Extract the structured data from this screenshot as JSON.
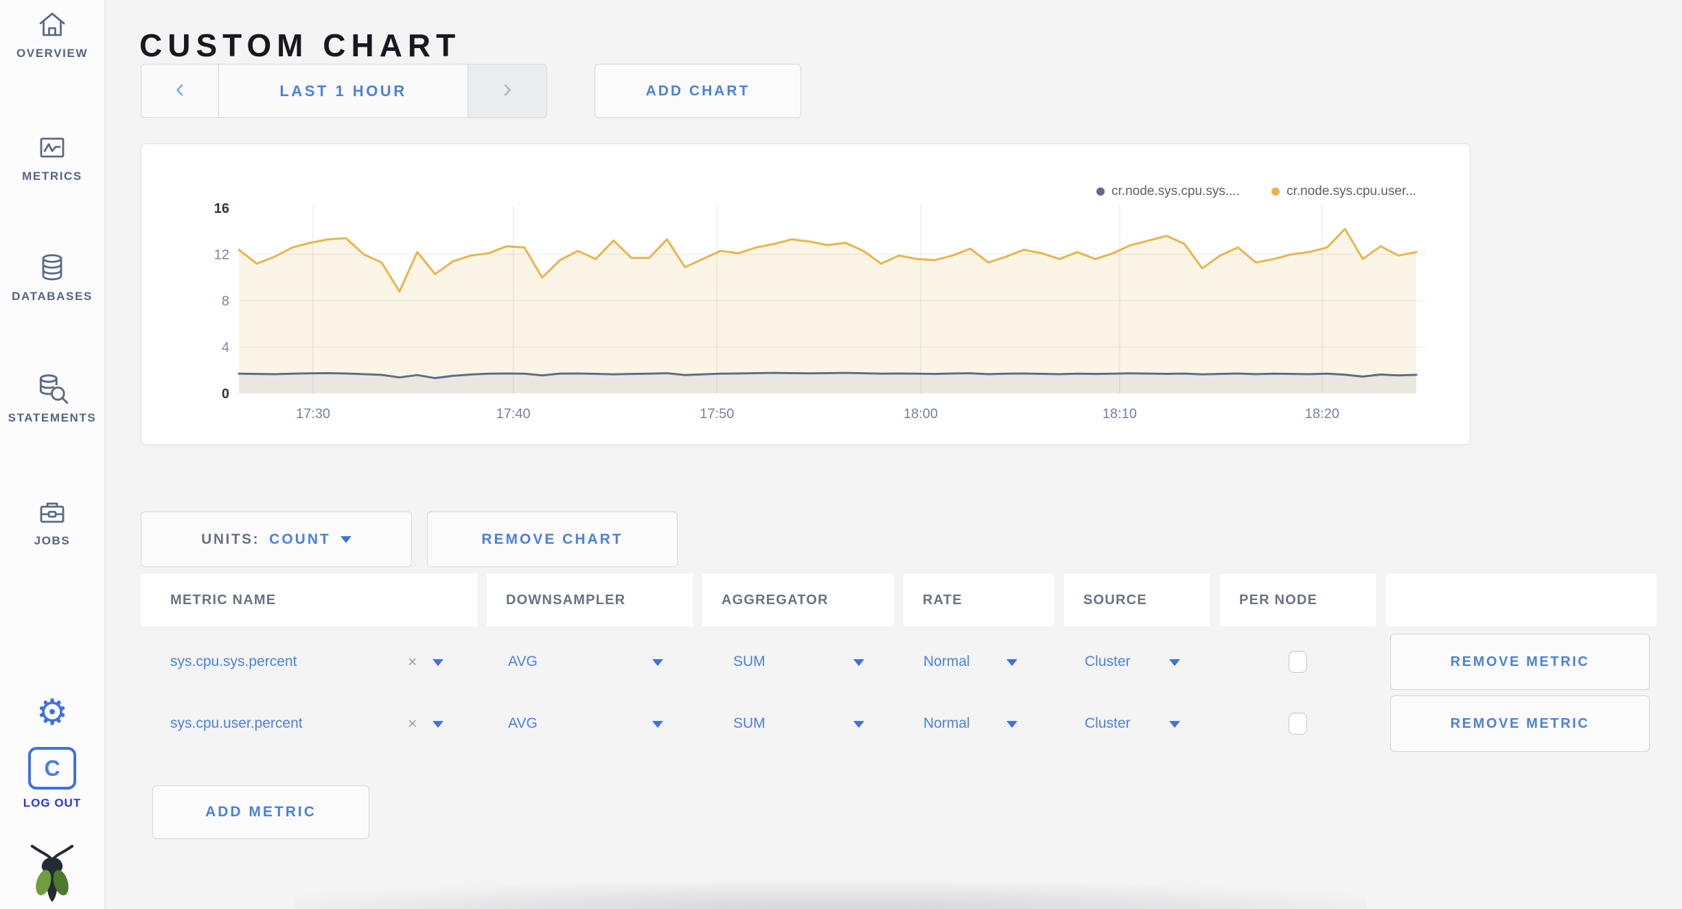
{
  "header": {
    "title": "CUSTOM CHART"
  },
  "sidebar": {
    "items": [
      {
        "label": "OVERVIEW",
        "icon": "home-icon"
      },
      {
        "label": "METRICS",
        "icon": "metrics-chart-icon"
      },
      {
        "label": "DATABASES",
        "icon": "database-icon"
      },
      {
        "label": "STATEMENTS",
        "icon": "statements-search-icon"
      },
      {
        "label": "JOBS",
        "icon": "briefcase-icon"
      }
    ],
    "settings_icon": "gear-icon",
    "settings_glyph": "⚙",
    "logout_icon": "cockroach-c-icon",
    "logout_monogram": "C",
    "logout_label": "LOG OUT",
    "brand_icon": "cockroachdb-bug-logo"
  },
  "toolbar": {
    "prev_icon": "‹",
    "time_range_label": "LAST 1 HOUR",
    "next_icon": "›",
    "add_chart_label": "ADD CHART"
  },
  "icons": {
    "dropdown": "triangle-down",
    "clear": "×"
  },
  "units_bar": {
    "units_label": "UNITS:",
    "units_value": "COUNT",
    "remove_chart_label": "REMOVE CHART"
  },
  "table": {
    "columns": [
      "METRIC NAME",
      "DOWNSAMPLER",
      "AGGREGATOR",
      "RATE",
      "SOURCE",
      "PER NODE"
    ],
    "rows": [
      {
        "metric": "sys.cpu.sys.percent",
        "downsampler": "AVG",
        "aggregator": "SUM",
        "rate": "Normal",
        "source": "Cluster",
        "per_node_checked": false,
        "remove_label": "REMOVE METRIC"
      },
      {
        "metric": "sys.cpu.user.percent",
        "downsampler": "AVG",
        "aggregator": "SUM",
        "rate": "Normal",
        "source": "Cluster",
        "per_node_checked": false,
        "remove_label": "REMOVE METRIC"
      }
    ],
    "add_metric_label": "ADD METRIC"
  },
  "colors": {
    "accent_blue": "#4a80df",
    "sidebar_icon": "#5b6985",
    "logout_blue": "#2335e8",
    "series_sys_gray": "#5f6c87",
    "series_user_yellow": "#e8b54a"
  },
  "chart_data": {
    "type": "area",
    "title": "",
    "xlabel": "",
    "ylabel": "",
    "x_range": [
      "17:26",
      "18:25"
    ],
    "ylim": [
      0,
      16
    ],
    "y_ticks": [
      0,
      4,
      8,
      12,
      16
    ],
    "y_grid": [
      4,
      8,
      12
    ],
    "x_ticks": [
      {
        "label": "17:30",
        "frac": 0.063
      },
      {
        "label": "17:40",
        "frac": 0.233
      },
      {
        "label": "17:50",
        "frac": 0.406
      },
      {
        "label": "18:00",
        "frac": 0.579
      },
      {
        "label": "18:10",
        "frac": 0.748
      },
      {
        "label": "18:20",
        "frac": 0.92
      }
    ],
    "grid": true,
    "legend_position": "top-right",
    "series": [
      {
        "name": "cr.node.sys.cpu.sys....",
        "color": "#5f6c87",
        "fill": "#eae7e0",
        "values": [
          1.7,
          1.68,
          1.66,
          1.7,
          1.73,
          1.75,
          1.72,
          1.66,
          1.6,
          1.38,
          1.58,
          1.32,
          1.52,
          1.63,
          1.7,
          1.72,
          1.7,
          1.55,
          1.71,
          1.72,
          1.69,
          1.65,
          1.68,
          1.7,
          1.74,
          1.58,
          1.64,
          1.7,
          1.72,
          1.75,
          1.77,
          1.75,
          1.73,
          1.75,
          1.77,
          1.74,
          1.7,
          1.72,
          1.7,
          1.68,
          1.72,
          1.74,
          1.66,
          1.7,
          1.72,
          1.69,
          1.66,
          1.7,
          1.68,
          1.7,
          1.73,
          1.71,
          1.69,
          1.71,
          1.65,
          1.68,
          1.72,
          1.66,
          1.7,
          1.68,
          1.66,
          1.7,
          1.62,
          1.45,
          1.63,
          1.55,
          1.6
        ]
      },
      {
        "name": "cr.node.sys.cpu.user...",
        "color": "#e8b54a",
        "fill": "#faf5e6",
        "values": [
          12.4,
          11.2,
          11.8,
          12.6,
          13.0,
          13.3,
          13.4,
          12.0,
          11.3,
          8.8,
          12.2,
          10.3,
          11.4,
          11.9,
          12.1,
          12.7,
          12.6,
          10.0,
          11.5,
          12.3,
          11.6,
          13.2,
          11.7,
          11.7,
          13.3,
          10.9,
          11.6,
          12.3,
          12.1,
          12.6,
          12.9,
          13.3,
          13.1,
          12.8,
          13.0,
          12.3,
          11.2,
          11.9,
          11.6,
          11.5,
          11.9,
          12.5,
          11.3,
          11.8,
          12.4,
          12.1,
          11.6,
          12.2,
          11.6,
          12.1,
          12.8,
          13.2,
          13.6,
          12.9,
          10.8,
          11.9,
          12.6,
          11.3,
          11.6,
          12.0,
          12.2,
          12.6,
          14.2,
          11.6,
          12.7,
          11.9,
          12.2
        ]
      }
    ]
  }
}
